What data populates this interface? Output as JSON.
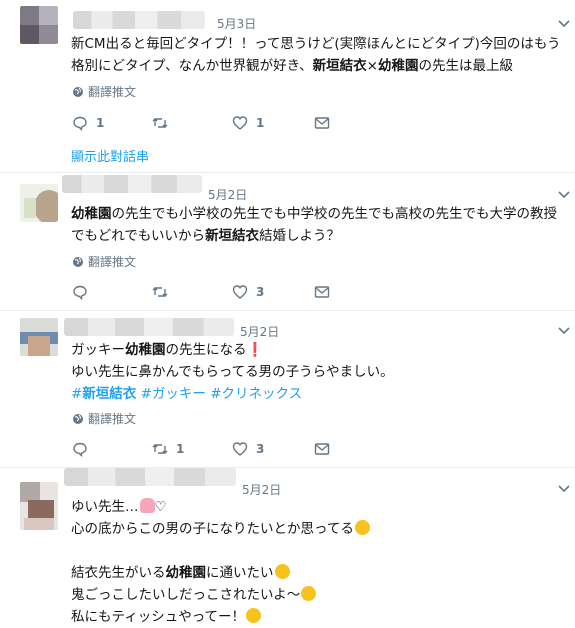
{
  "tweets": [
    {
      "date": "5月3日",
      "lines": [
        [
          {
            "t": "新CM出ると毎回どタイプ！！って思うけど(実際ほんとにどタイプ)今回のはもう"
          }
        ],
        [
          {
            "t": "格別にどタイプ、なんか世界観が好き、"
          },
          {
            "t": "新垣結衣",
            "b": true
          },
          {
            "t": "×"
          },
          {
            "t": "幼稚園",
            "b": true
          },
          {
            "t": "の先生は最上級"
          }
        ]
      ],
      "translate": "翻譯推文",
      "reply_count": "1",
      "retweet_count": "",
      "like_count": "1",
      "thread_link": "顯示此對話串"
    },
    {
      "date": "5月2日",
      "lines": [
        [
          {
            "t": "幼稚園",
            "b": true
          },
          {
            "t": "の先生でも小学校の先生でも中学校の先生でも高校の先生でも大学の教授"
          }
        ],
        [
          {
            "t": "でもどれでもいいから"
          },
          {
            "t": "新垣結衣",
            "b": true
          },
          {
            "t": "結婚しよう？"
          }
        ]
      ],
      "translate": "翻譯推文",
      "reply_count": "",
      "retweet_count": "",
      "like_count": "3"
    },
    {
      "date": "5月2日",
      "lines": [
        [
          {
            "t": "ガッキー"
          },
          {
            "t": "幼稚園",
            "b": true
          },
          {
            "t": "の先生になる"
          },
          {
            "t": "❗",
            "red": true
          }
        ],
        [
          {
            "t": "ゆい先生に鼻かんでもらってる男の子うらやましい。"
          }
        ],
        [
          {
            "t": "#",
            "tag": true
          },
          {
            "t": "新垣結衣",
            "tag": true,
            "b": true
          },
          {
            "t": " #ガッキー #クリネックス",
            "tag": true
          }
        ]
      ],
      "translate": "翻譯推文",
      "reply_count": "",
      "retweet_count": "1",
      "like_count": "3"
    },
    {
      "date": "5月2日",
      "lines": [
        [
          {
            "t": "ゆい先生…"
          },
          {
            "emoji": "tulip"
          },
          {
            "t": "♡"
          }
        ],
        [
          {
            "t": "心の底からこの男の子になりたいとか思ってる"
          },
          {
            "emoji": "tongue"
          }
        ],
        [
          {
            "t": ""
          }
        ],
        [
          {
            "t": "結衣先生がいる"
          },
          {
            "t": "幼稚園",
            "b": true
          },
          {
            "t": "に通いたい"
          },
          {
            "emoji": "hearteyes"
          }
        ],
        [
          {
            "t": "鬼ごっこしたいしだっこされたいよ〜"
          },
          {
            "emoji": "cry"
          }
        ],
        [
          {
            "t": "私にもティッシュやってー！"
          },
          {
            "emoji": "persevere"
          }
        ]
      ]
    }
  ],
  "colors": {
    "link": "#1da1f2",
    "meta": "#657786",
    "text": "#14171a",
    "divider": "#e6ecf0"
  }
}
